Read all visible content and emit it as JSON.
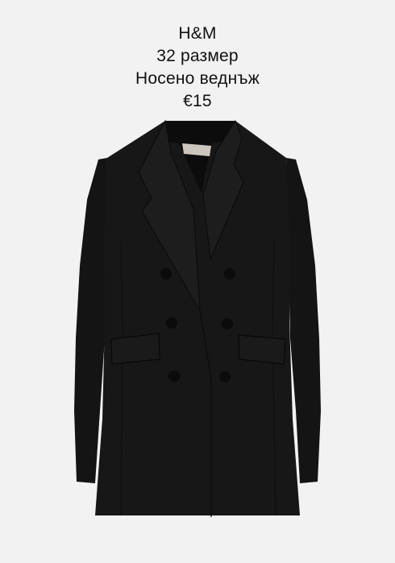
{
  "listing": {
    "brand": "H&M",
    "size": "32 размер",
    "condition": "Носено веднъж",
    "price": "€15"
  },
  "photo": {
    "subject": "jacket-icon",
    "colors": {
      "background": "#f2f2f2",
      "fabric": "#161616",
      "lining": "#0c0c0c",
      "label": "#cdc6bf"
    }
  }
}
